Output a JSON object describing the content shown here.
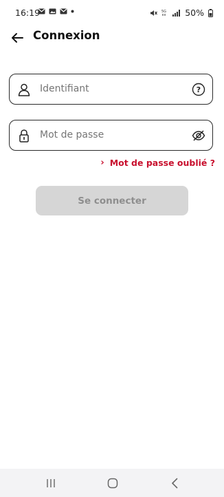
{
  "status": {
    "time": "16:19",
    "battery": "50%"
  },
  "header": {
    "title": "Connexion"
  },
  "login": {
    "username_placeholder": "Identifiant",
    "password_placeholder": "Mot de passe",
    "forgot_label": "Mot de passe oublié ?",
    "submit_label": "Se connecter"
  },
  "icons": {
    "back": "arrow-left-icon",
    "user": "user-icon",
    "help": "question-icon",
    "lock": "lock-icon",
    "eye": "eye-off-icon",
    "chevron": "chevron-right-icon"
  },
  "colors": {
    "accent": "#c8102e",
    "button_disabled": "#d6d6d6",
    "button_text_disabled": "#8e8e8e"
  }
}
